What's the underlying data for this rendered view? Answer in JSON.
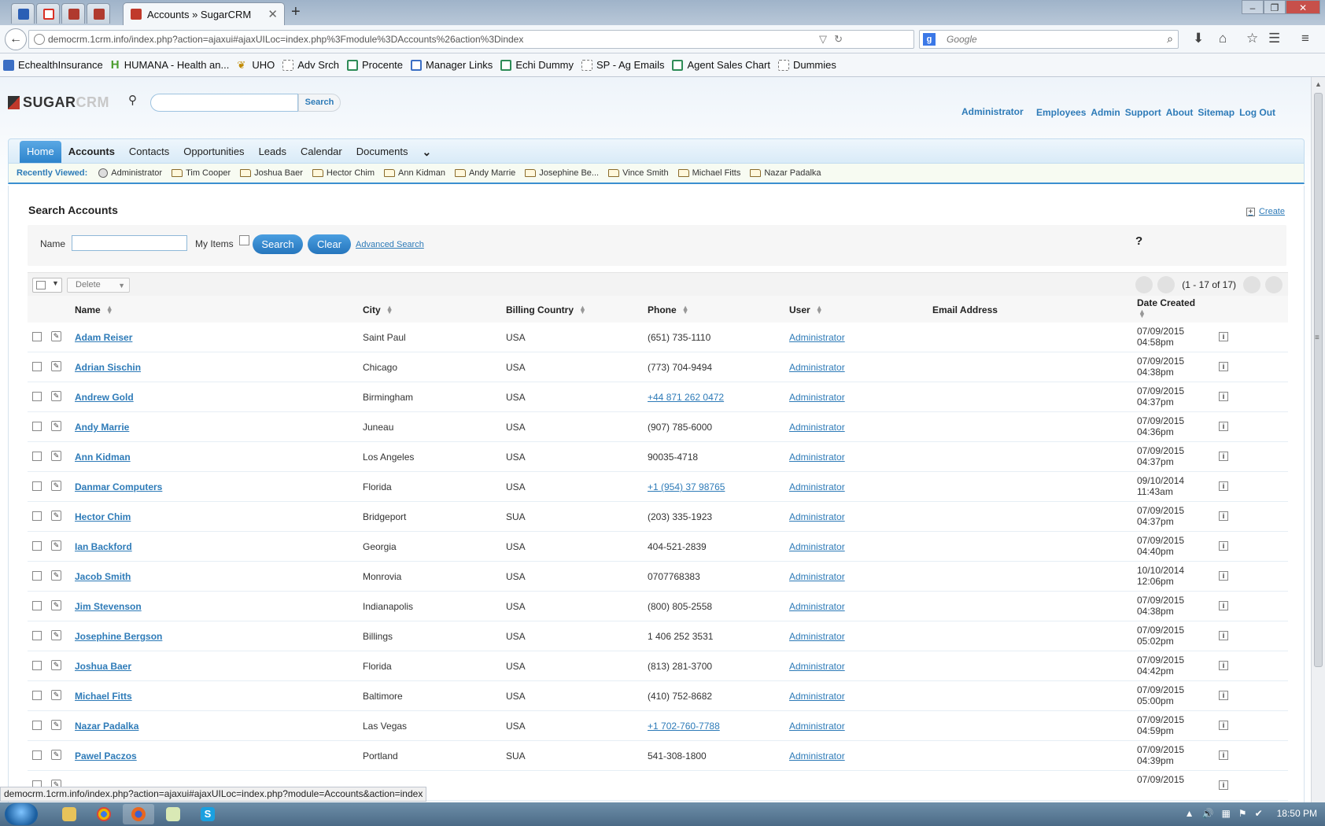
{
  "browser": {
    "active_tab_title": "Accounts » SugarCRM",
    "url": "democrm.1crm.info/index.php?action=ajaxui#ajaxUILoc=index.php%3Fmodule%3DAccounts%26action%3Dindex",
    "search_placeholder": "Google",
    "status_url": "democrm.1crm.info/index.php?action=ajaxui#ajaxUILoc=index.php?module=Accounts&action=index",
    "bookmarks": [
      {
        "label": "EchealthInsurance",
        "icon": "book-icon"
      },
      {
        "label": "HUMANA - Health an...",
        "icon": "humana-icon"
      },
      {
        "label": "UHO",
        "icon": "uho-icon"
      },
      {
        "label": "Adv Srch",
        "icon": "folder-icon"
      },
      {
        "label": "Procente",
        "icon": "sheet-icon"
      },
      {
        "label": "Manager Links",
        "icon": "page-icon"
      },
      {
        "label": "Echi Dummy",
        "icon": "sheet-icon"
      },
      {
        "label": "SP - Ag Emails",
        "icon": "folder-icon"
      },
      {
        "label": "Agent Sales Chart",
        "icon": "sheet-icon"
      },
      {
        "label": "Dummies",
        "icon": "folder-icon"
      }
    ]
  },
  "header": {
    "logo_part1": "SUGAR",
    "logo_part2": "CRM",
    "search_button": "Search",
    "user": "Administrator",
    "links": [
      "Employees",
      "Admin",
      "Support",
      "About",
      "Sitemap",
      "Log Out"
    ]
  },
  "modules": [
    "Home",
    "Accounts",
    "Contacts",
    "Opportunities",
    "Leads",
    "Calendar",
    "Documents"
  ],
  "recently_viewed": {
    "label": "Recently Viewed:",
    "items": [
      "Administrator",
      "Tim Cooper",
      "Joshua Baer",
      "Hector Chim",
      "Ann Kidman",
      "Andy Marrie",
      "Josephine Be...",
      "Vince Smith",
      "Michael Fitts",
      "Nazar Padalka"
    ]
  },
  "search_panel": {
    "title": "Search Accounts",
    "create": "Create",
    "name_label": "Name",
    "name_value": "",
    "my_items_label": "My Items",
    "search_button": "Search",
    "clear_button": "Clear",
    "advanced_link": "Advanced Search",
    "help": "?"
  },
  "list": {
    "delete_button": "Delete",
    "pagination": "(1 - 17 of 17)",
    "columns": {
      "name": "Name",
      "city": "City",
      "country": "Billing Country",
      "phone": "Phone",
      "user": "User",
      "email": "Email Address",
      "date": "Date Created"
    },
    "rows": [
      {
        "name": "Adam Reiser",
        "city": "Saint Paul",
        "country": "USA",
        "phone": "(651) 735-1110",
        "phone_link": false,
        "user": "Administrator",
        "date": "07/09/2015",
        "time": "04:58pm"
      },
      {
        "name": "Adrian Sischin",
        "city": "Chicago",
        "country": "USA",
        "phone": "(773) 704-9494",
        "phone_link": false,
        "user": "Administrator",
        "date": "07/09/2015",
        "time": "04:38pm"
      },
      {
        "name": "Andrew Gold",
        "city": "Birmingham",
        "country": "USA",
        "phone": "+44 871 262 0472",
        "phone_link": true,
        "user": "Administrator",
        "date": "07/09/2015",
        "time": "04:37pm"
      },
      {
        "name": "Andy Marrie",
        "city": "Juneau",
        "country": "USA",
        "phone": "(907) 785-6000",
        "phone_link": false,
        "user": "Administrator",
        "date": "07/09/2015",
        "time": "04:36pm"
      },
      {
        "name": "Ann Kidman",
        "city": "Los Angeles",
        "country": "USA",
        "phone": "90035-4718",
        "phone_link": false,
        "user": "Administrator",
        "date": "07/09/2015",
        "time": "04:37pm"
      },
      {
        "name": "Danmar Computers",
        "city": "Florida",
        "country": "USA",
        "phone": "+1 (954) 37 98765",
        "phone_link": true,
        "user": "Administrator",
        "date": "09/10/2014",
        "time": "11:43am"
      },
      {
        "name": "Hector Chim",
        "city": "Bridgeport",
        "country": "SUA",
        "phone": "(203) 335-1923",
        "phone_link": false,
        "user": "Administrator",
        "date": "07/09/2015",
        "time": "04:37pm"
      },
      {
        "name": "Ian Backford",
        "city": "Georgia",
        "country": "USA",
        "phone": "404-521-2839",
        "phone_link": false,
        "user": "Administrator",
        "date": "07/09/2015",
        "time": "04:40pm"
      },
      {
        "name": "Jacob Smith",
        "city": "Monrovia",
        "country": "USA",
        "phone": "0707768383",
        "phone_link": false,
        "user": "Administrator",
        "date": "10/10/2014",
        "time": "12:06pm"
      },
      {
        "name": "Jim Stevenson",
        "city": "Indianapolis",
        "country": "USA",
        "phone": "(800) 805-2558",
        "phone_link": false,
        "user": "Administrator",
        "date": "07/09/2015",
        "time": "04:38pm"
      },
      {
        "name": "Josephine Bergson",
        "city": "Billings",
        "country": "USA",
        "phone": "1 406 252 3531",
        "phone_link": false,
        "user": "Administrator",
        "date": "07/09/2015",
        "time": "05:02pm"
      },
      {
        "name": "Joshua Baer",
        "city": "Florida",
        "country": "USA",
        "phone": "(813) 281-3700",
        "phone_link": false,
        "user": "Administrator",
        "date": "07/09/2015",
        "time": "04:42pm"
      },
      {
        "name": "Michael Fitts",
        "city": "Baltimore",
        "country": "USA",
        "phone": "(410) 752-8682",
        "phone_link": false,
        "user": "Administrator",
        "date": "07/09/2015",
        "time": "05:00pm"
      },
      {
        "name": "Nazar Padalka",
        "city": "Las Vegas",
        "country": "USA",
        "phone": "+1 702-760-7788",
        "phone_link": true,
        "user": "Administrator",
        "date": "07/09/2015",
        "time": "04:59pm"
      },
      {
        "name": "Pawel Paczos",
        "city": "Portland",
        "country": "SUA",
        "phone": "541-308-1800",
        "phone_link": false,
        "user": "Administrator",
        "date": "07/09/2015",
        "time": "04:39pm"
      },
      {
        "name": "",
        "city": "",
        "country": "",
        "phone": "",
        "phone_link": false,
        "user": "",
        "date": "07/09/2015",
        "time": ""
      }
    ]
  },
  "taskbar": {
    "clock": "18:50 PM"
  },
  "colors": {
    "link": "#2e7bb8",
    "accent": "#3b8fd0"
  }
}
